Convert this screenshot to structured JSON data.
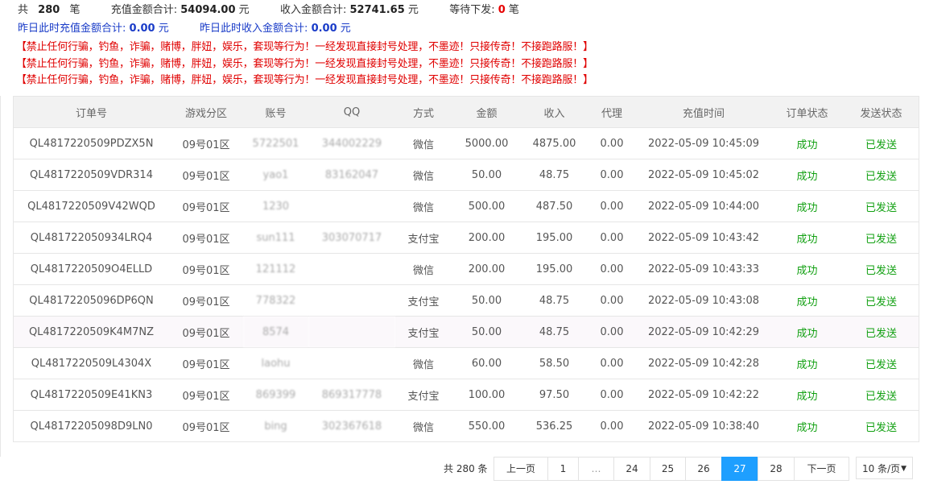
{
  "summary": {
    "count_prefix": "共",
    "count_value": "280",
    "count_suffix": "笔",
    "recharge_label": "充值金额合计:",
    "recharge_value": "54094.00",
    "recharge_unit": "元",
    "income_label": "收入金额合计:",
    "income_value": "52741.65",
    "income_unit": "元",
    "pending_label": "等待下发:",
    "pending_value": "0",
    "pending_unit": "笔"
  },
  "yesterday": {
    "recharge_label": "昨日此时充值金额合计:",
    "recharge_value": "0.00",
    "recharge_unit": "元",
    "income_label": "昨日此时收入金额合计:",
    "income_value": "0.00",
    "income_unit": "元"
  },
  "warnings": [
    "【禁止任何行骗，钓鱼，诈骗，赌博，胖妞，娱乐，套现等行为！一经发现直接封号处理，不墨迹！只接传奇！不接跑路服！】",
    "【禁止任何行骗，钓鱼，诈骗，赌博，胖妞，娱乐，套现等行为！一经发现直接封号处理，不墨迹！只接传奇！不接跑路服！】",
    "【禁止任何行骗，钓鱼，诈骗，赌博，胖妞，娱乐，套现等行为！一经发现直接封号处理，不墨迹！只接传奇！不接跑路服！】"
  ],
  "table": {
    "headers": [
      "订单号",
      "游戏分区",
      "账号",
      "QQ",
      "方式",
      "金额",
      "收入",
      "代理",
      "充值时间",
      "订单状态",
      "发送状态"
    ],
    "rows": [
      [
        "QL4817220509PDZX5N",
        "09号01区",
        "5722501",
        "344002229",
        "微信",
        "5000.00",
        "4875.00",
        "0.00",
        "2022-05-09 10:45:09",
        "成功",
        "已发送"
      ],
      [
        "QL4817220509VDR314",
        "09号01区",
        "yao1",
        "83162047",
        "微信",
        "50.00",
        "48.75",
        "0.00",
        "2022-05-09 10:45:02",
        "成功",
        "已发送"
      ],
      [
        "QL4817220509V42WQD",
        "09号01区",
        "1230",
        "",
        "微信",
        "500.00",
        "487.50",
        "0.00",
        "2022-05-09 10:44:00",
        "成功",
        "已发送"
      ],
      [
        "QL481722050934LRQ4",
        "09号01区",
        "sun111",
        "303070717",
        "支付宝",
        "200.00",
        "195.00",
        "0.00",
        "2022-05-09 10:43:42",
        "成功",
        "已发送"
      ],
      [
        "QL4817220509O4ELLD",
        "09号01区",
        "121112",
        "",
        "微信",
        "200.00",
        "195.00",
        "0.00",
        "2022-05-09 10:43:33",
        "成功",
        "已发送"
      ],
      [
        "QL48172205096DP6QN",
        "09号01区",
        "778322",
        "",
        "支付宝",
        "50.00",
        "48.75",
        "0.00",
        "2022-05-09 10:43:08",
        "成功",
        "已发送"
      ],
      [
        "QL4817220509K4M7NZ",
        "09号01区",
        "8574",
        "",
        "支付宝",
        "50.00",
        "48.75",
        "0.00",
        "2022-05-09 10:42:29",
        "成功",
        "已发送"
      ],
      [
        "QL4817220509L4304X",
        "09号01区",
        "laohu",
        "",
        "微信",
        "60.00",
        "58.50",
        "0.00",
        "2022-05-09 10:42:28",
        "成功",
        "已发送"
      ],
      [
        "QL4817220509E41KN3",
        "09号01区",
        "869399",
        "869317778",
        "支付宝",
        "100.00",
        "97.50",
        "0.00",
        "2022-05-09 10:42:22",
        "成功",
        "已发送"
      ],
      [
        "QL48172205098D9LN0",
        "09号01区",
        "bing",
        "302367618",
        "微信",
        "550.00",
        "536.25",
        "0.00",
        "2022-05-09 10:38:40",
        "成功",
        "已发送"
      ]
    ]
  },
  "pagination": {
    "total_label": "共 280 条",
    "prev_label": "上一页",
    "next_label": "下一页",
    "pages": [
      "1",
      "…",
      "24",
      "25",
      "26",
      "27",
      "28"
    ],
    "current": "27",
    "per_page": "10 条/页",
    "caret": "▼"
  }
}
